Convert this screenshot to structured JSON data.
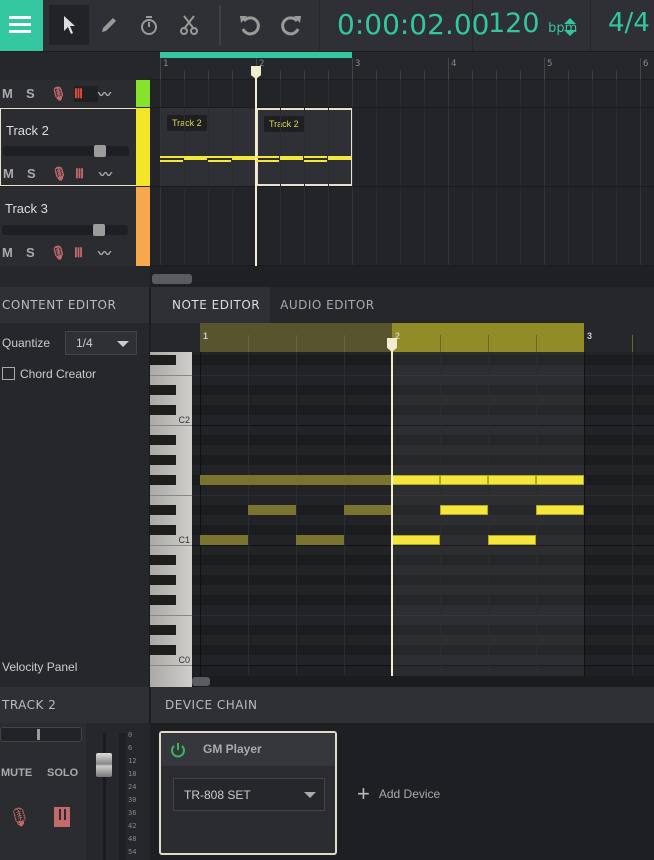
{
  "toolbar": {
    "tools": [
      {
        "name": "select-tool",
        "icon": "pointer-icon",
        "active": true
      },
      {
        "name": "pencil-tool",
        "icon": "pencil-icon"
      },
      {
        "name": "metronome-tool",
        "icon": "stopwatch-icon"
      },
      {
        "name": "cut-tool",
        "icon": "scissors-icon"
      }
    ],
    "time": "0:00:02.00",
    "tempo": "120",
    "tempo_unit": "bpm",
    "time_signature": "4/4"
  },
  "colors": {
    "accent": "#33c69f",
    "note": "#f5e63b",
    "note_dim": "#7a7430",
    "track1": "#86e22a",
    "track2": "#f3e52a",
    "track3": "#f7a84c"
  },
  "timeline": {
    "bars": [
      "1",
      "2",
      "3",
      "4",
      "5",
      "6"
    ],
    "loop_start_bar": 1,
    "loop_end_bar": 3,
    "playhead_bar": 2
  },
  "tracks": [
    {
      "name": "",
      "mute": "M",
      "solo": "S"
    },
    {
      "name": "Track 2",
      "mute": "M",
      "solo": "S",
      "clips": [
        "Track 2",
        "Track 2"
      ],
      "volume": 0.76
    },
    {
      "name": "Track 3",
      "mute": "M",
      "solo": "S",
      "volume": 0.76
    }
  ],
  "content_editor": {
    "title": "CONTENT EDITOR",
    "quantize_label": "Quantize",
    "quantize_value": "1/4",
    "chord_creator": "Chord Creator",
    "chord_checked": false,
    "velocity_panel": "Velocity Panel"
  },
  "tabs": [
    {
      "label": "NOTE EDITOR",
      "active": true
    },
    {
      "label": "AUDIO EDITOR",
      "active": false
    }
  ],
  "note_editor": {
    "bars": [
      "1",
      "2",
      "3"
    ],
    "key_labels": {
      "c2": "C2",
      "c1": "C1",
      "c0": "C0"
    },
    "notes": [
      {
        "pitch": "F#1",
        "start": 0,
        "length": 4,
        "selected": false
      },
      {
        "pitch": "F#1",
        "start": 4,
        "length": 1,
        "selected": true
      },
      {
        "pitch": "F#1",
        "start": 5,
        "length": 1,
        "selected": true
      },
      {
        "pitch": "F#1",
        "start": 6,
        "length": 1,
        "selected": true
      },
      {
        "pitch": "F#1",
        "start": 7,
        "length": 1,
        "selected": true
      },
      {
        "pitch": "D#1",
        "start": 1,
        "length": 1,
        "selected": false
      },
      {
        "pitch": "D#1",
        "start": 3,
        "length": 1,
        "selected": false
      },
      {
        "pitch": "D#1",
        "start": 5,
        "length": 1,
        "selected": true
      },
      {
        "pitch": "D#1",
        "start": 7,
        "length": 1,
        "selected": true
      },
      {
        "pitch": "C1",
        "start": 0,
        "length": 1,
        "selected": false
      },
      {
        "pitch": "C1",
        "start": 2,
        "length": 1,
        "selected": false
      },
      {
        "pitch": "C1",
        "start": 4,
        "length": 1,
        "selected": true
      },
      {
        "pitch": "C1",
        "start": 6,
        "length": 1,
        "selected": true
      }
    ]
  },
  "mixer": {
    "title": "TRACK 2",
    "mute": "MUTE",
    "solo": "SOLO",
    "meter_labels": [
      "0",
      "6",
      "12",
      "18",
      "24",
      "30",
      "36",
      "42",
      "48",
      "54"
    ]
  },
  "device_chain": {
    "title": "DEVICE CHAIN",
    "device_name": "GM Player",
    "preset": "TR-808 SET",
    "add_device": "Add Device"
  }
}
